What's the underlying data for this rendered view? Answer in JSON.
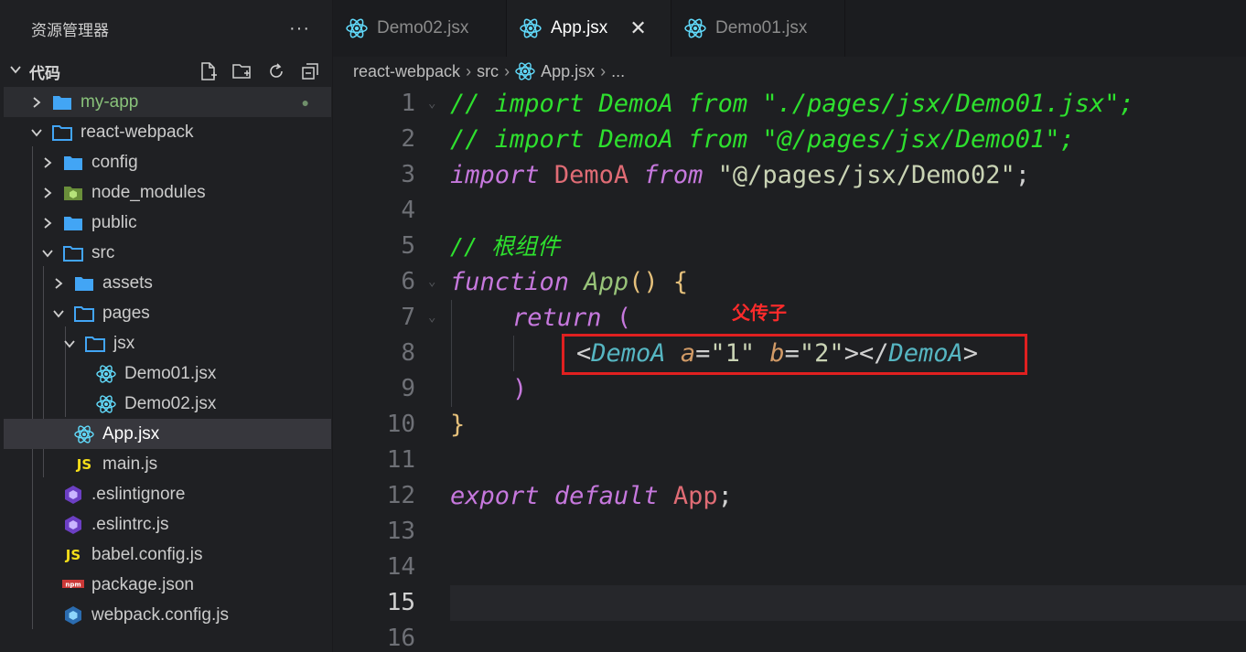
{
  "explorer": {
    "title": "资源管理器",
    "more": "···",
    "section": "代码",
    "actions": [
      "new-file-icon",
      "new-folder-icon",
      "refresh-icon",
      "collapse-all-icon"
    ],
    "tree": [
      {
        "label": "my-app",
        "icon": "folder-icon",
        "chevron": "right",
        "status_dot": "●"
      },
      {
        "label": "react-webpack",
        "icon": "folder-open-icon",
        "chevron": "down"
      },
      {
        "label": "config",
        "icon": "folder-icon",
        "chevron": "right"
      },
      {
        "label": "node_modules",
        "icon": "node-folder-icon",
        "chevron": "right"
      },
      {
        "label": "public",
        "icon": "folder-icon",
        "chevron": "right"
      },
      {
        "label": "src",
        "icon": "folder-open-icon",
        "chevron": "down"
      },
      {
        "label": "assets",
        "icon": "folder-icon",
        "chevron": "right"
      },
      {
        "label": "pages",
        "icon": "folder-open-icon",
        "chevron": "down"
      },
      {
        "label": "jsx",
        "icon": "folder-open-icon",
        "chevron": "down"
      },
      {
        "label": "Demo01.jsx",
        "icon": "react-icon"
      },
      {
        "label": "Demo02.jsx",
        "icon": "react-icon"
      },
      {
        "label": "App.jsx",
        "icon": "react-icon"
      },
      {
        "label": "main.js",
        "icon": "js-icon"
      },
      {
        "label": ".eslintignore",
        "icon": "eslint-icon"
      },
      {
        "label": ".eslintrc.js",
        "icon": "eslint-icon"
      },
      {
        "label": "babel.config.js",
        "icon": "js-icon"
      },
      {
        "label": "package.json",
        "icon": "npm-icon"
      },
      {
        "label": "webpack.config.js",
        "icon": "webpack-icon"
      }
    ]
  },
  "tabs": [
    {
      "label": "Demo02.jsx",
      "active": false
    },
    {
      "label": "App.jsx",
      "active": true,
      "close": "✕"
    },
    {
      "label": "Demo01.jsx",
      "active": false
    }
  ],
  "breadcrumb": {
    "parts": [
      "react-webpack",
      "src",
      "App.jsx",
      "..."
    ],
    "sep": "›"
  },
  "editor": {
    "line_numbers": [
      "1",
      "2",
      "3",
      "4",
      "5",
      "6",
      "7",
      "8",
      "9",
      "10",
      "11",
      "12",
      "13",
      "14",
      "15",
      "16"
    ],
    "current_line": "15",
    "line1": "// import DemoA from \"./pages/jsx/Demo01.jsx\";",
    "line2": "// import DemoA from \"@/pages/jsx/Demo01\";",
    "line3": {
      "kw": "import",
      "id": "DemoA",
      "from": "from",
      "str": "\"@/pages/jsx/Demo02\"",
      "semi": ";"
    },
    "line5": "// 根组件",
    "line6": {
      "kw": "function",
      "fn": "App",
      "parens": "()",
      "brace": "{"
    },
    "line7": {
      "kw": "return",
      "paren": "("
    },
    "line8": {
      "lt": "<",
      "tag": "DemoA",
      "attr_a": "a",
      "eq": "=",
      "val_a": "\"1\"",
      "attr_b": "b",
      "val_b": "\"2\"",
      "close_open": "></",
      "tag2": "DemoA",
      "gt": ">"
    },
    "line9": {
      "paren": ")"
    },
    "line10": {
      "brace": "}"
    },
    "line12": {
      "kw1": "export",
      "kw2": "default",
      "id": "App",
      "semi": ";"
    }
  },
  "annotation": {
    "text": "父传子",
    "color": "#e02020"
  },
  "colors": {
    "comment": "#2ee02e",
    "keyword": "#c678dd",
    "identifier": "#e06c75",
    "string": "#c9d3b4",
    "function": "#98c379",
    "tag": "#56b6c2",
    "attr": "#d19a66",
    "folder": "#42a5f5",
    "react": "#61dafb",
    "js": "#f5de19"
  }
}
